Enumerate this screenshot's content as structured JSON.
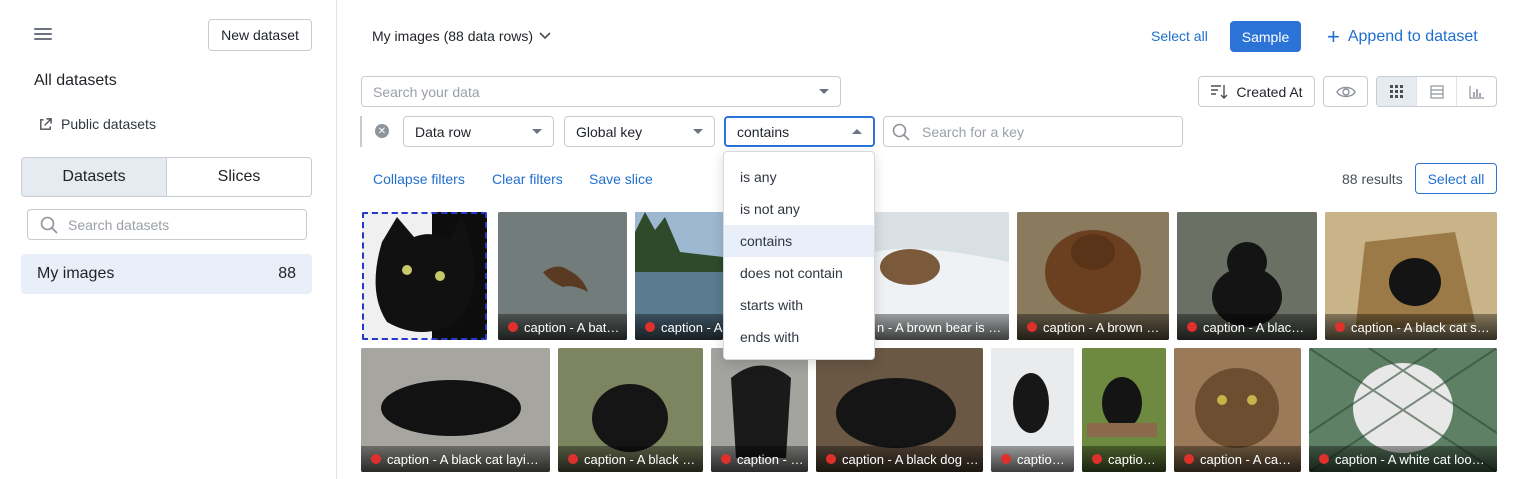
{
  "sidebar": {
    "new_dataset": "New dataset",
    "all_datasets": "All datasets",
    "public_datasets": "Public datasets",
    "tabs": [
      "Datasets",
      "Slices"
    ],
    "search_placeholder": "Search datasets",
    "items": [
      {
        "label": "My images",
        "count": "88"
      }
    ]
  },
  "header": {
    "title": "My images (88 data rows)",
    "select_all": "Select all",
    "sample": "Sample",
    "append": "Append to dataset"
  },
  "toolbar": {
    "search_placeholder": "Search your data",
    "sort_label": "Created At"
  },
  "filter": {
    "field": "Data row",
    "attribute": "Global key",
    "operator": "contains",
    "key_placeholder": "Search for a key",
    "operator_options": [
      "is any",
      "is not any",
      "contains",
      "does not contain",
      "starts with",
      "ends with"
    ],
    "highlighted": "contains"
  },
  "actions": {
    "collapse": "Collapse filters",
    "clear": "Clear filters",
    "save_slice": "Save slice",
    "results": "88 results",
    "select_all": "Select all"
  },
  "grid": {
    "row1": [
      "",
      "caption - A bat…",
      "caption - A …",
      "n - A brown bear is …",
      "caption - A brown …",
      "caption - A blac…",
      "caption - A black cat s…"
    ],
    "row2": [
      "caption - A black cat layi…",
      "caption - A black …",
      "caption - …",
      "caption - A black dog …",
      "captio…",
      "captio…",
      "caption - A ca…",
      "caption - A white cat loo…"
    ]
  },
  "colors": {
    "accent": "#2b73d6",
    "status_dot": "#e0302c"
  }
}
